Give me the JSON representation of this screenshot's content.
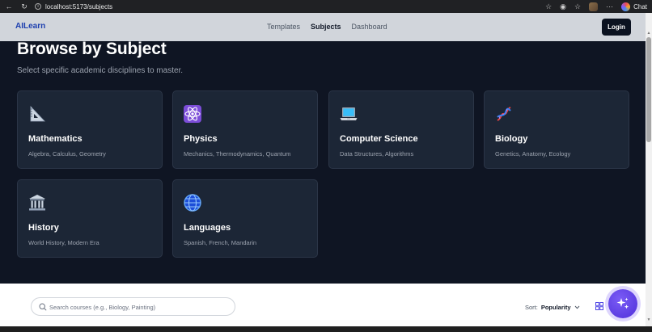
{
  "browser": {
    "url": "localhost:5173/subjects",
    "chat_label": "Chat"
  },
  "header": {
    "brand": "AILearn",
    "nav": [
      {
        "label": "Templates"
      },
      {
        "label": "Subjects",
        "active": true
      },
      {
        "label": "Dashboard"
      }
    ],
    "login_label": "Login"
  },
  "main": {
    "title": "Browse by Subject",
    "subtitle": "Select specific academic disciplines to master.",
    "subjects": [
      {
        "name": "Mathematics",
        "desc": "Algebra, Calculus, Geometry",
        "icon": "triangle-ruler-icon"
      },
      {
        "name": "Physics",
        "desc": "Mechanics, Thermodynamics, Quantum",
        "icon": "atom-icon"
      },
      {
        "name": "Computer Science",
        "desc": "Data Structures, Algorithms",
        "icon": "laptop-icon"
      },
      {
        "name": "Biology",
        "desc": "Genetics, Anatomy, Ecology",
        "icon": "dna-icon"
      },
      {
        "name": "History",
        "desc": "World History, Modern Era",
        "icon": "classical-building-icon"
      },
      {
        "name": "Languages",
        "desc": "Spanish, French, Mandarin",
        "icon": "globe-icon"
      }
    ]
  },
  "toolbar": {
    "search_placeholder": "Search courses (e.g., Biology, Painting)",
    "sort_label": "Sort:",
    "sort_value": "Popularity"
  },
  "colors": {
    "page_bg": "#0f1523",
    "card_bg": "#1c2636",
    "header_bg": "#d1d5db",
    "brand": "#1e40af",
    "fab": "#6d4af0"
  }
}
